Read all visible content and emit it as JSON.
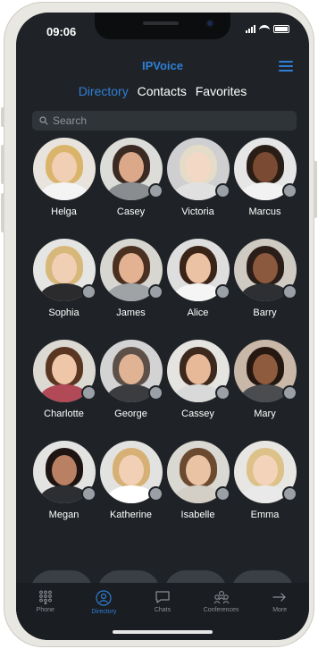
{
  "status_bar": {
    "time": "09:06"
  },
  "header": {
    "title": "IPVoice",
    "menu_icon": "hamburger-icon"
  },
  "tabs": [
    {
      "label": "Directory",
      "active": true
    },
    {
      "label": "Contacts",
      "active": false
    },
    {
      "label": "Favorites",
      "active": false
    }
  ],
  "search": {
    "placeholder": "Search"
  },
  "contacts": [
    {
      "name": "Helga",
      "status": "online"
    },
    {
      "name": "Casey",
      "status": "offline"
    },
    {
      "name": "Victoria",
      "status": "offline"
    },
    {
      "name": "Marcus",
      "status": "offline"
    },
    {
      "name": "Sophia",
      "status": "offline"
    },
    {
      "name": "James",
      "status": "offline"
    },
    {
      "name": "Alice",
      "status": "offline"
    },
    {
      "name": "Barry",
      "status": "offline"
    },
    {
      "name": "Charlotte",
      "status": "offline"
    },
    {
      "name": "George",
      "status": "offline"
    },
    {
      "name": "Cassey",
      "status": "offline"
    },
    {
      "name": "Mary",
      "status": "offline"
    },
    {
      "name": "Megan",
      "status": "offline"
    },
    {
      "name": "Katherine",
      "status": "offline"
    },
    {
      "name": "Isabelle",
      "status": "offline"
    },
    {
      "name": "Emma",
      "status": "offline"
    }
  ],
  "bottom_nav": [
    {
      "label": "Phone",
      "icon": "dialpad-icon",
      "active": false
    },
    {
      "label": "Directory",
      "icon": "directory-icon",
      "active": true
    },
    {
      "label": "Chats",
      "icon": "chat-icon",
      "active": false
    },
    {
      "label": "Conferences",
      "icon": "conferences-icon",
      "active": false
    },
    {
      "label": "More",
      "icon": "more-arrow-icon",
      "active": false
    }
  ],
  "colors": {
    "accent": "#2f7fd6",
    "background": "#1f2327",
    "status_offline": "#9aa0a6"
  }
}
